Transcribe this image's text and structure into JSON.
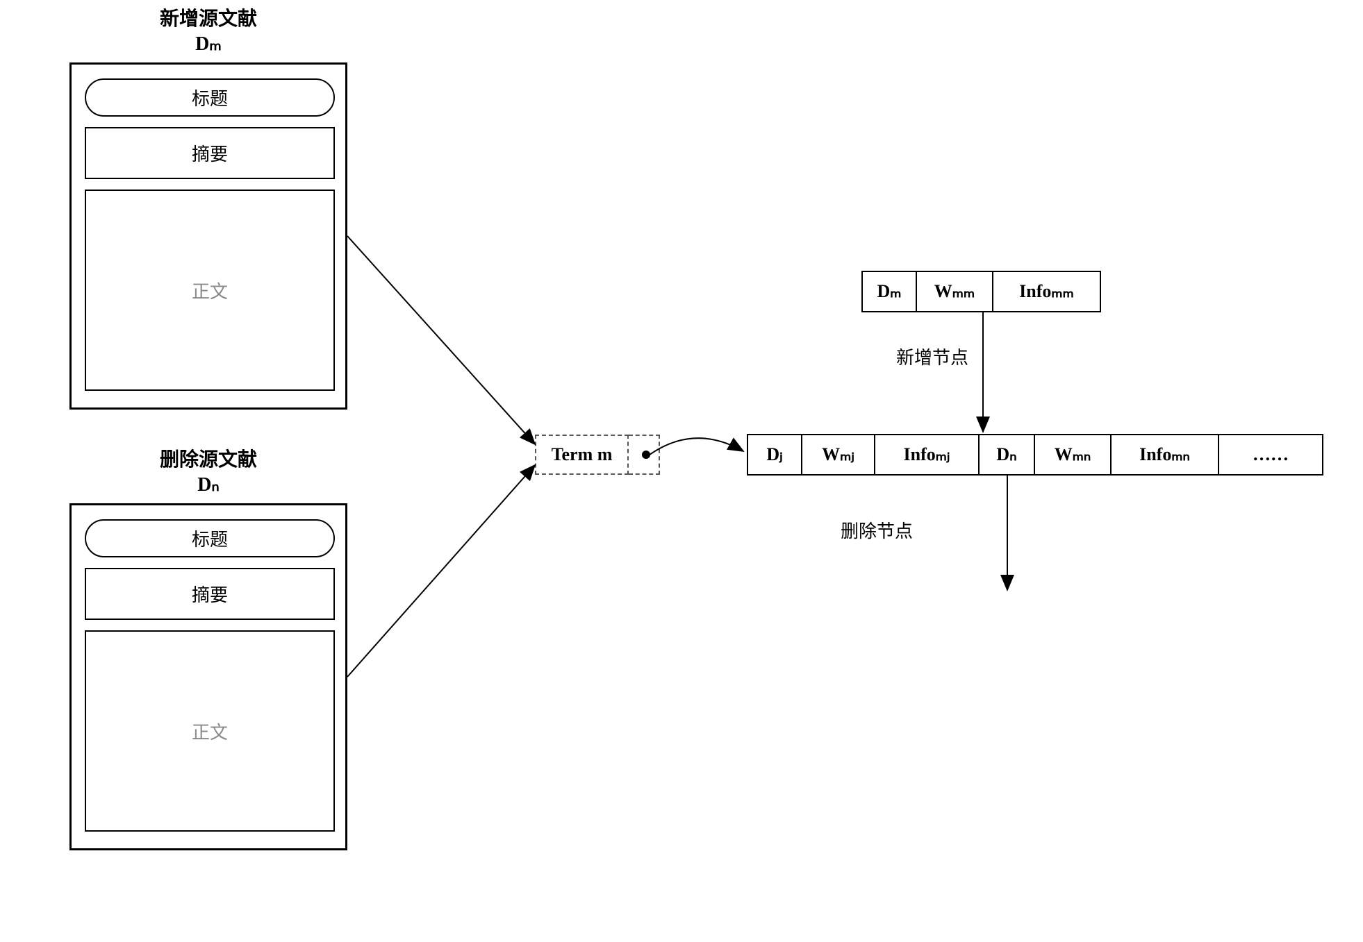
{
  "docM": {
    "titleLine1": "新增源文献",
    "titleLine2": "Dₘ",
    "partTitle": "标题",
    "partAbstract": "摘要",
    "partBody": "正文"
  },
  "docN": {
    "titleLine1": "删除源文献",
    "titleLine2": "Dₙ",
    "partTitle": "标题",
    "partAbstract": "摘要",
    "partBody": "正文"
  },
  "term": {
    "label": "Term m"
  },
  "newNode": {
    "d": "Dₘ",
    "w": "Wₘₘ",
    "info": "Infoₘₘ"
  },
  "listNodes": {
    "n1_d": "Dⱼ",
    "n1_w": "Wₘⱼ",
    "n1_info": "Infoₘⱼ",
    "n2_d": "Dₙ",
    "n2_w": "Wₘₙ",
    "n2_info": "Infoₘₙ",
    "ellipsis": "……"
  },
  "annotations": {
    "addNode": "新增节点",
    "deleteNode": "删除节点"
  }
}
